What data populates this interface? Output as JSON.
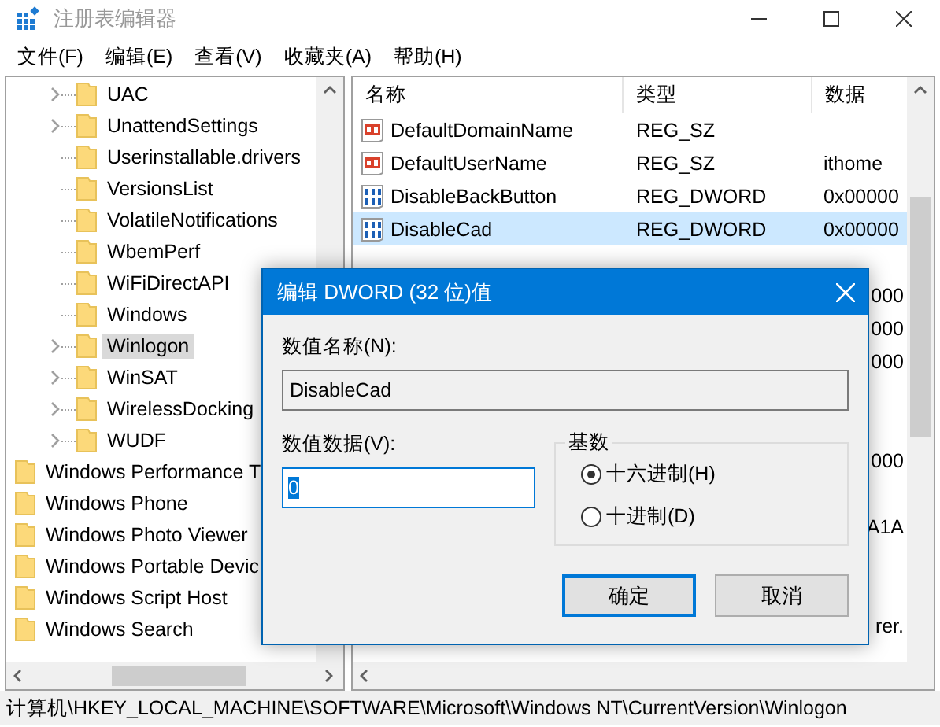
{
  "window": {
    "title": "注册表编辑器"
  },
  "menu": [
    "文件(F)",
    "编辑(E)",
    "查看(V)",
    "收藏夹(A)",
    "帮助(H)"
  ],
  "tree": [
    {
      "children": [
        {
          "children": [
            {
              "label": "UAC",
              "expandable": true,
              "selected": false
            },
            {
              "label": "UnattendSettings",
              "expandable": true,
              "selected": false
            },
            {
              "label": "Userinstallable.drivers",
              "expandable": false,
              "selected": false
            },
            {
              "label": "VersionsList",
              "expandable": false,
              "selected": false
            },
            {
              "label": "VolatileNotifications",
              "expandable": false,
              "selected": false
            },
            {
              "label": "WbemPerf",
              "expandable": false,
              "selected": false
            },
            {
              "label": "WiFiDirectAPI",
              "expandable": false,
              "selected": false
            },
            {
              "label": "Windows",
              "expandable": false,
              "selected": false
            },
            {
              "label": "Winlogon",
              "expandable": true,
              "selected": true
            },
            {
              "label": "WinSAT",
              "expandable": true,
              "selected": false
            },
            {
              "label": "WirelessDocking",
              "expandable": true,
              "selected": false
            },
            {
              "label": "WUDF",
              "expandable": true,
              "selected": false
            }
          ]
        }
      ]
    },
    {
      "label": "Windows Performance T",
      "selected": false
    },
    {
      "label": "Windows Phone",
      "selected": false
    },
    {
      "label": "Windows Photo Viewer",
      "selected": false
    },
    {
      "label": "Windows Portable Devic",
      "selected": false
    },
    {
      "label": "Windows Script Host",
      "selected": false
    },
    {
      "label": "Windows Search",
      "selected": false
    }
  ],
  "table": {
    "columns": [
      "名称",
      "类型",
      "数据"
    ],
    "rows": [
      {
        "kind": "string",
        "name": "DefaultDomainName",
        "type": "REG_SZ",
        "selected": false
      },
      {
        "kind": "string",
        "name": "DefaultUserName",
        "type": "REG_SZ",
        "data": "ithome",
        "selected": false
      },
      {
        "kind": "dword",
        "name": "DisableBackButton",
        "type": "REG_DWORD",
        "data": "0x00000",
        "selected": false
      },
      {
        "kind": "dword",
        "name": "DisableCad",
        "type": "REG_DWORD",
        "data": "0x00000",
        "selected": true
      },
      {
        "selected": false
      },
      {
        "data": "000",
        "selected": false
      },
      {
        "data": "000",
        "selected": false
      },
      {
        "data": "000",
        "selected": false
      },
      {
        "selected": false
      },
      {
        "selected": false
      },
      {
        "data": "000",
        "selected": false
      },
      {
        "selected": false
      },
      {
        "data": "A1A",
        "selected": false
      },
      {
        "selected": false
      },
      {
        "selected": false
      },
      {
        "data": "rer.",
        "selected": false
      }
    ]
  },
  "status_bar": "计算机\\HKEY_LOCAL_MACHINE\\SOFTWARE\\Microsoft\\Windows NT\\CurrentVersion\\Winlogon",
  "dialog": {
    "title": "编辑 DWORD (32 位)值",
    "name_label": "数值名称(N):",
    "name_value": "DisableCad",
    "data_label": "数值数据(V):",
    "data_value": "0",
    "base_label": "基数",
    "bases": [
      {
        "label": "十六进制(H)",
        "selected": true
      },
      {
        "label": "十进制(D)",
        "selected": false
      }
    ],
    "buttons": [
      {
        "label": "确定",
        "default": true
      },
      {
        "label": "取消",
        "default": false
      }
    ]
  }
}
